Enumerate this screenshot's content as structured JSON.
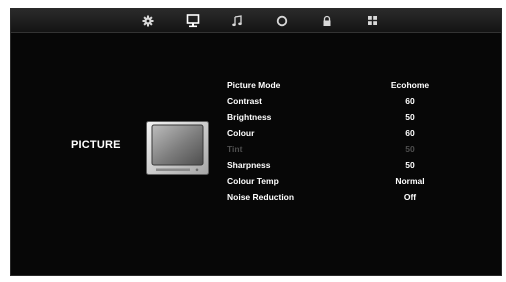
{
  "tabs": [
    {
      "name": "setup",
      "icon": "gear-icon"
    },
    {
      "name": "picture",
      "icon": "monitor-icon",
      "active": true
    },
    {
      "name": "sound",
      "icon": "music-note-icon"
    },
    {
      "name": "time",
      "icon": "clock-icon"
    },
    {
      "name": "lock",
      "icon": "lock-icon"
    },
    {
      "name": "channel",
      "icon": "grid-icon"
    }
  ],
  "section": {
    "title": "PICTURE",
    "icon": "tv-icon"
  },
  "menu": [
    {
      "label": "Picture Mode",
      "value": "Ecohome"
    },
    {
      "label": "Contrast",
      "value": "60"
    },
    {
      "label": "Brightness",
      "value": "50"
    },
    {
      "label": "Colour",
      "value": "60"
    },
    {
      "label": "Tint",
      "value": "50",
      "disabled": true
    },
    {
      "label": "Sharpness",
      "value": "50"
    },
    {
      "label": "Colour Temp",
      "value": "Normal"
    },
    {
      "label": "Noise Reduction",
      "value": "Off"
    }
  ],
  "colors": {
    "background": "#070707",
    "text": "#ffffff",
    "disabled_text": "#4e4e4e"
  }
}
